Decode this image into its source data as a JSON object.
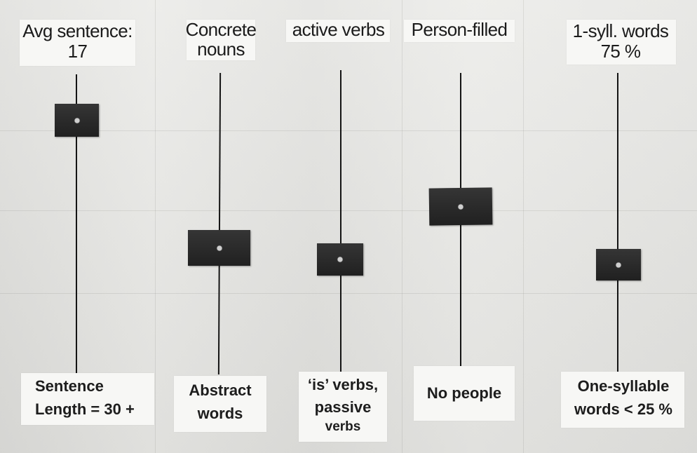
{
  "scales": [
    {
      "top_label": [
        "Avg sentence:",
        "17"
      ],
      "bottom_label": [
        "Sentence",
        "Length = 30 +"
      ],
      "marker_level": 0.88
    },
    {
      "top_label": [
        "Concrete",
        "nouns"
      ],
      "bottom_label": [
        "Abstract",
        "words"
      ],
      "marker_level": 0.46
    },
    {
      "top_label": [
        "active verbs"
      ],
      "bottom_label": [
        "‘is’ verbs,",
        "passive",
        "verbs"
      ],
      "marker_level": 0.38
    },
    {
      "top_label": [
        "Person-filled"
      ],
      "bottom_label": [
        "No people"
      ],
      "marker_level": 0.56
    },
    {
      "top_label": [
        "1-syll. words",
        "75 %"
      ],
      "bottom_label": [
        "One-syllable",
        "words < 25 %"
      ],
      "marker_level": 0.35
    }
  ]
}
